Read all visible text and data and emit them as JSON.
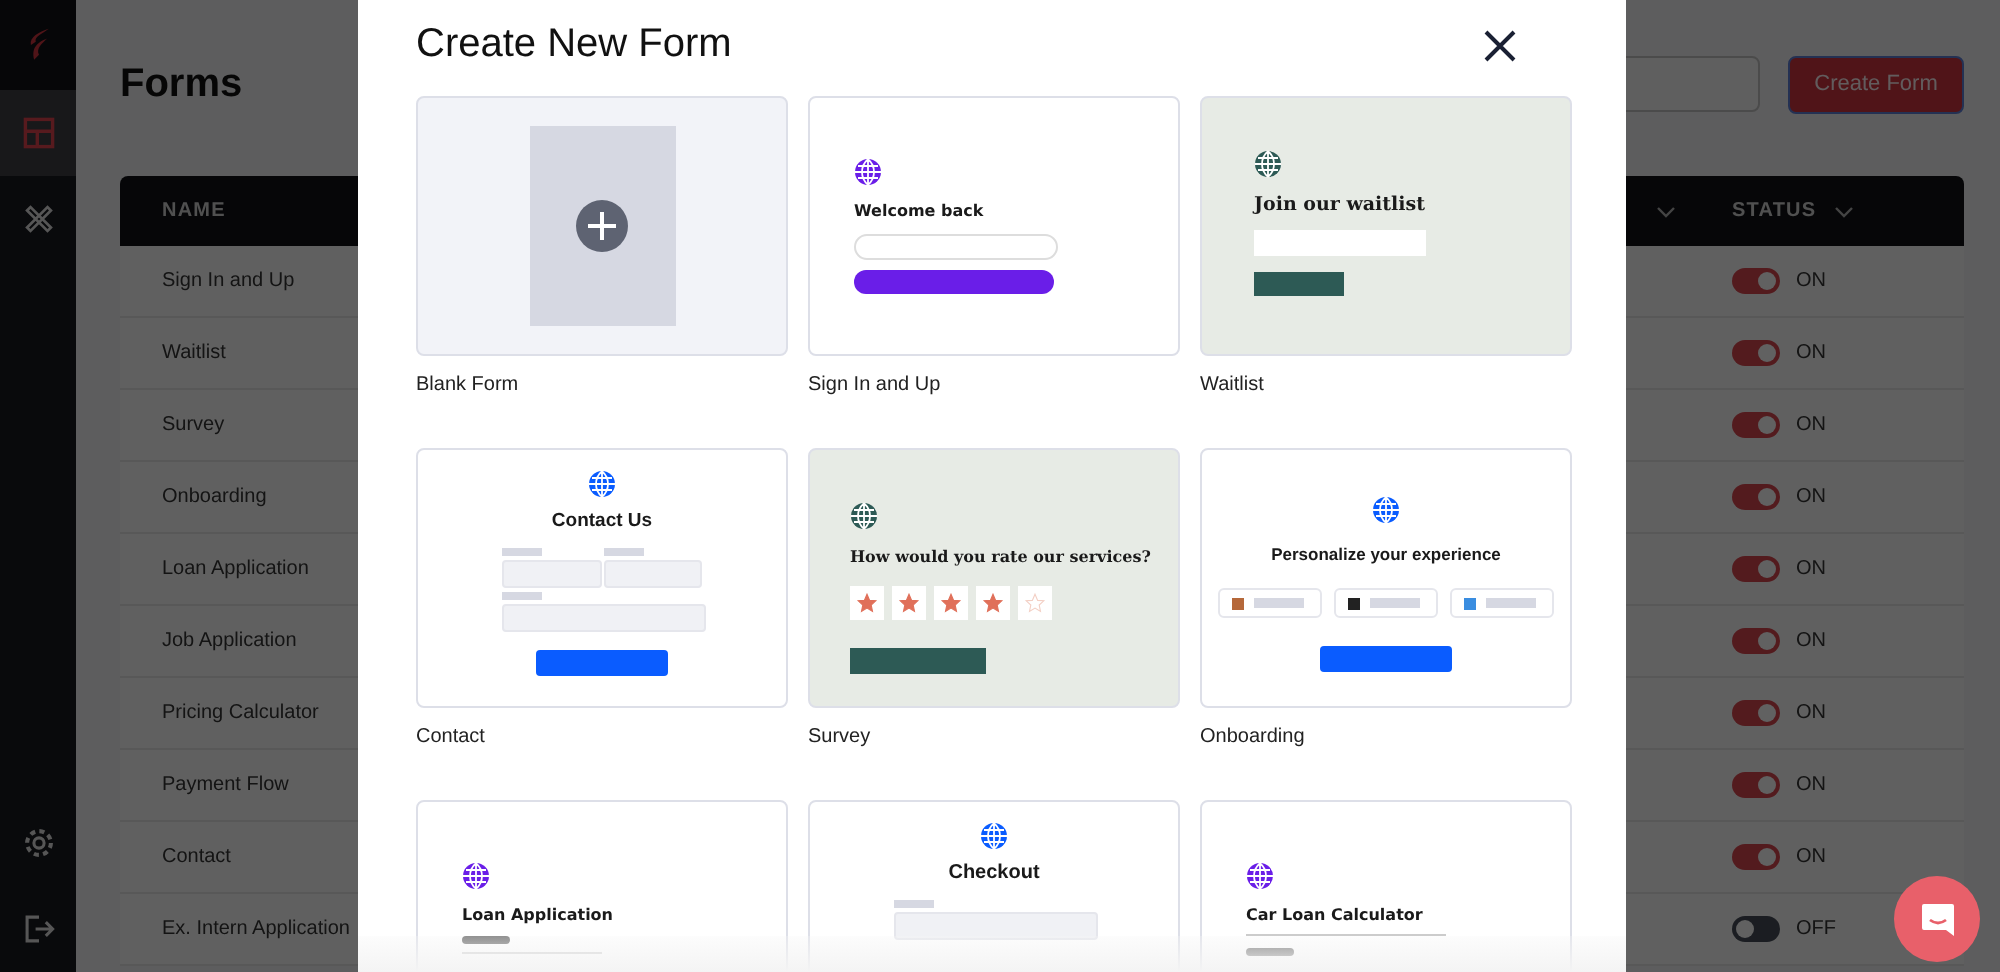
{
  "sidebar": {
    "items": [
      {
        "selected": true
      },
      {
        "selected": false
      }
    ]
  },
  "page": {
    "title": "Forms",
    "create_button": "Create Form"
  },
  "table": {
    "columns": [
      "NAME",
      "STATUS"
    ],
    "rows": [
      {
        "name": "Sign In and Up",
        "on": true,
        "status": "ON"
      },
      {
        "name": "Waitlist",
        "on": true,
        "status": "ON"
      },
      {
        "name": "Survey",
        "on": true,
        "status": "ON"
      },
      {
        "name": "Onboarding",
        "on": true,
        "status": "ON"
      },
      {
        "name": "Loan Application",
        "on": true,
        "status": "ON"
      },
      {
        "name": "Job Application",
        "on": true,
        "status": "ON"
      },
      {
        "name": "Pricing Calculator",
        "on": true,
        "status": "ON"
      },
      {
        "name": "Payment Flow",
        "on": true,
        "status": "ON"
      },
      {
        "name": "Contact",
        "on": true,
        "status": "ON"
      },
      {
        "name": "Ex. Intern Application",
        "on": false,
        "status": "OFF"
      }
    ]
  },
  "modal": {
    "title": "Create New Form",
    "templates": [
      {
        "kind": "blank",
        "label": "Blank Form"
      },
      {
        "kind": "signin",
        "label": "Sign In and Up",
        "color": "#6a1ee8",
        "heading": "Welcome back"
      },
      {
        "kind": "waitlist",
        "label": "Waitlist",
        "color": "#2d5a55",
        "heading": "Join our waitlist"
      },
      {
        "kind": "contact",
        "label": "Contact",
        "color": "#0a5cff",
        "heading": "Contact Us"
      },
      {
        "kind": "survey",
        "label": "Survey",
        "color": "#2d5a55",
        "heading": "How would you rate our services?",
        "stars": 4
      },
      {
        "kind": "onboarding",
        "label": "Onboarding",
        "color": "#0a5cff",
        "heading": "Personalize your experience"
      },
      {
        "kind": "loan",
        "color": "#6a1ee8",
        "heading": "Loan Application"
      },
      {
        "kind": "checkout",
        "color": "#0a5cff",
        "heading": "Checkout"
      },
      {
        "kind": "carloan",
        "color": "#6a1ee8",
        "heading": "Car Loan Calculator"
      }
    ]
  }
}
